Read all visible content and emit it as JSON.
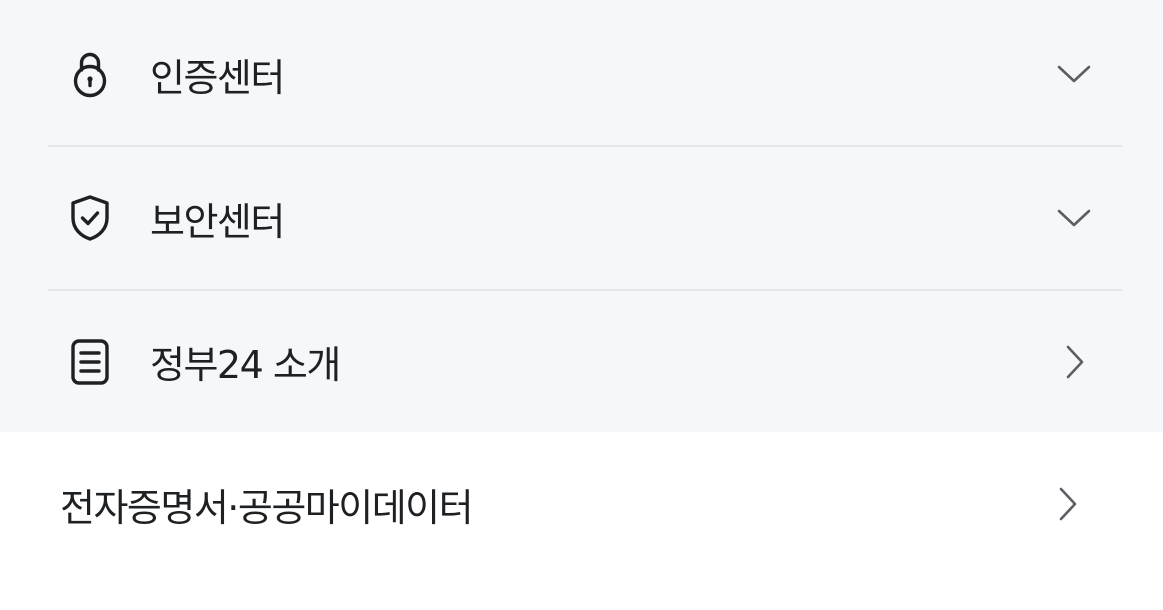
{
  "menu": {
    "items": [
      {
        "label": "인증센터",
        "icon": "lock-icon",
        "indicator": "chevron-down-icon"
      },
      {
        "label": "보안센터",
        "icon": "shield-check-icon",
        "indicator": "chevron-down-icon"
      },
      {
        "label": "정부24 소개",
        "icon": "document-icon",
        "indicator": "chevron-right-icon"
      }
    ],
    "link": {
      "label": "전자증명서·공공마이데이터",
      "indicator": "chevron-right-icon"
    }
  },
  "colors": {
    "panel_background": "#f6f7f9",
    "page_background": "#ffffff",
    "text": "#1e2124",
    "divider": "#e3e6ea",
    "chevron": "#5a5f66"
  }
}
